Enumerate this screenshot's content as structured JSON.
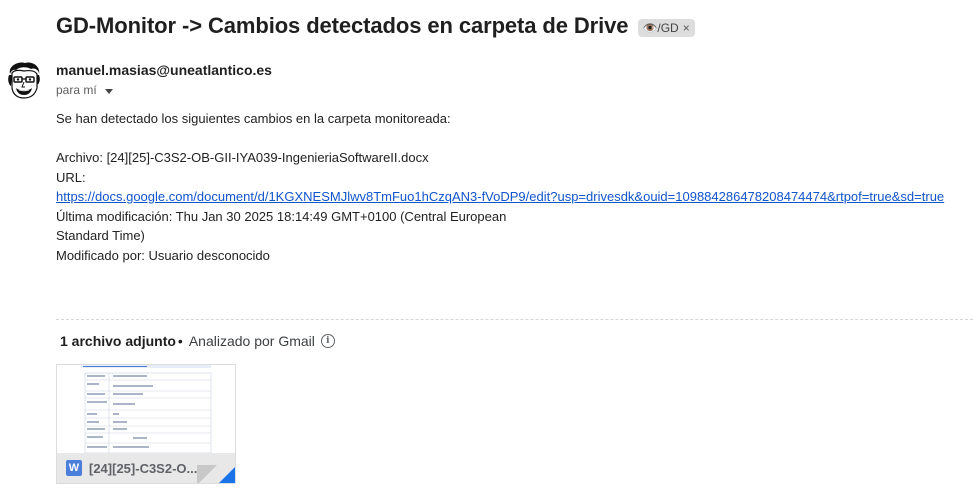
{
  "email": {
    "subject": "GD-Monitor -> Cambios detectados en carpeta de Drive",
    "label": {
      "icon": "eye-emoji-icon",
      "text": "👁️/GD",
      "remove": "×"
    },
    "sender": "manuel.masias@uneatlantico.es",
    "recipient": "para mí",
    "body": {
      "intro": "Se han detectado los siguientes cambios en la carpeta monitoreada:",
      "file_line": "Archivo: [24][25]-C3S2-OB-GII-IYA039-IngenieriaSoftwareII.docx",
      "url_label": "URL:",
      "url": "https://docs.google.com/document/d/1KGXNESMJlwv8TmFuo1hCzqAN3-fVoDP9/edit?usp=drivesdk&ouid=109884286478208474474&rtpof=true&sd=true",
      "modified_line1": "Última modificación: Thu Jan 30 2025 18:14:49 GMT+0100 (Central European",
      "modified_line2": "Standard Time)",
      "modified_by": "Modificado por: Usuario desconocido"
    }
  },
  "attachments": {
    "count_label": "1 archivo adjunto",
    "separator": "•",
    "scan_label": "Analizado por Gmail",
    "info_icon": "info-icon",
    "items": [
      {
        "name": "[24][25]-C3S2-O...",
        "type_icon": "word-doc-icon",
        "type_letter": "W"
      }
    ]
  },
  "colors": {
    "link": "#1155cc",
    "word_icon": "#4a80dc",
    "fold": "#1a73e8",
    "chip": "#dddddd"
  }
}
